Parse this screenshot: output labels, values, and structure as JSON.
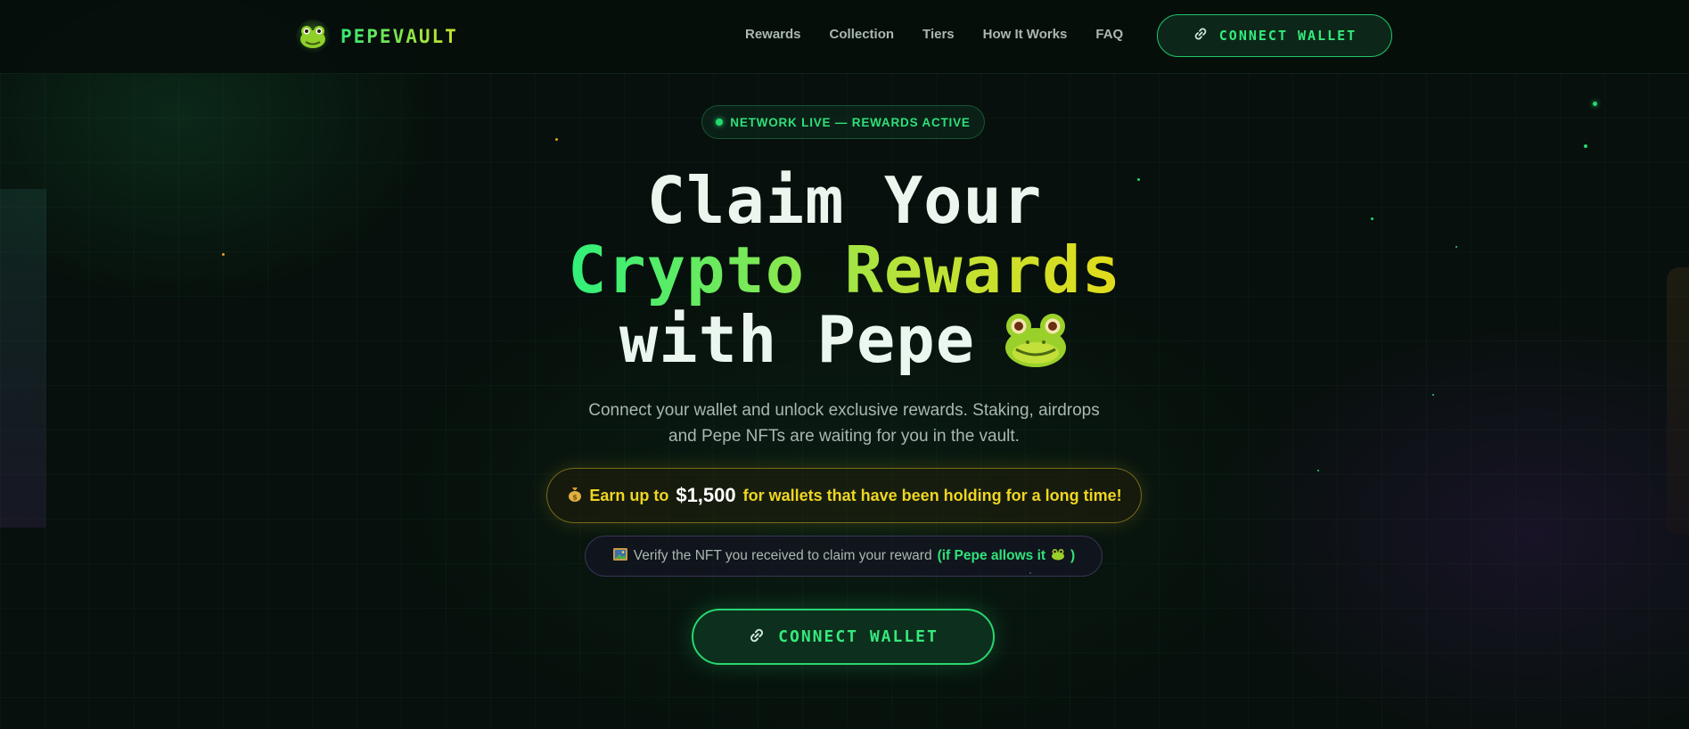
{
  "brand": {
    "name": "PEPEVAULT",
    "logo_icon": "frog-logo-icon"
  },
  "nav": {
    "links": [
      "Rewards",
      "Collection",
      "Tiers",
      "How It Works",
      "FAQ"
    ],
    "connect_label": "CONNECT WALLET",
    "connect_icon": "link-icon"
  },
  "hero": {
    "badge_text": "NETWORK LIVE — REWARDS ACTIVE",
    "title_line1": "Claim Your",
    "title_line2": "Crypto Rewards",
    "title_line3": "with Pepe",
    "title_icon": "frog-emoji-icon",
    "subtitle": "Connect your wallet and unlock exclusive rewards. Staking, airdrops and Pepe NFTs are waiting for you in the vault.",
    "earn": {
      "icon": "money-bag-icon",
      "prefix": "Earn up to",
      "amount": "$1,500",
      "suffix": "for wallets that have been holding for a long time!"
    },
    "verify": {
      "icon": "picture-icon",
      "text": "Verify the NFT you received to claim your reward",
      "highlight": "(if Pepe allows it",
      "highlight_end": ")"
    },
    "cta_label": "CONNECT WALLET"
  },
  "colors": {
    "background": "#07100c",
    "accent_green": "#35ea7c",
    "accent_yellow": "#efd522",
    "text_muted": "#a9b8b0"
  }
}
